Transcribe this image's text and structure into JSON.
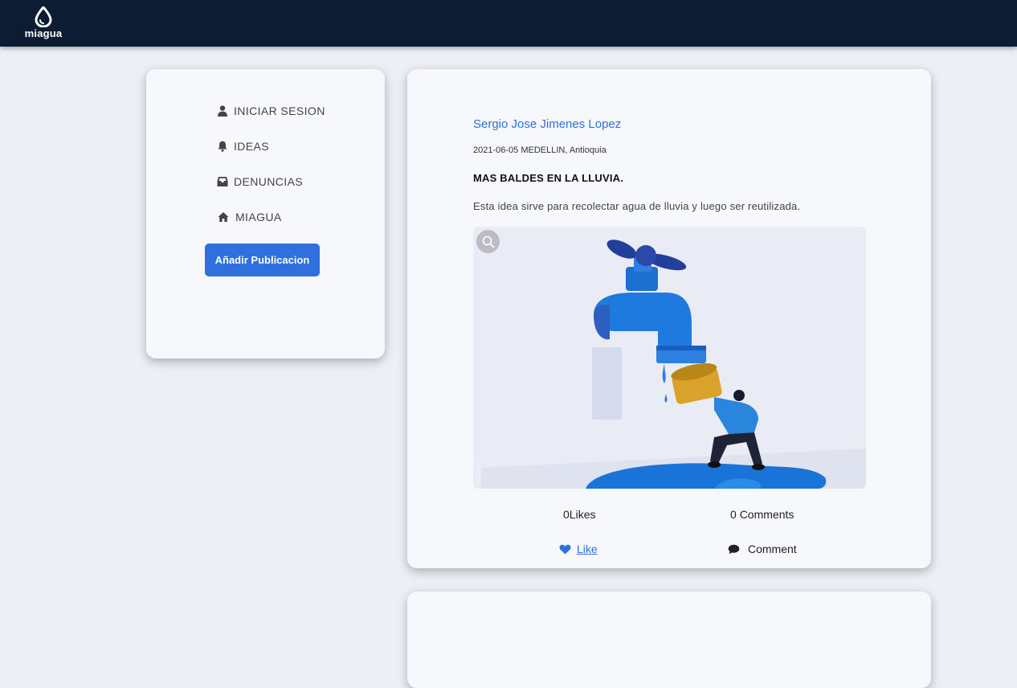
{
  "brand": {
    "name": "miagua"
  },
  "sidebar": {
    "items": [
      {
        "label": "INICIAR SESION",
        "icon": "user-icon"
      },
      {
        "label": "IDEAS",
        "icon": "bell-icon"
      },
      {
        "label": "DENUNCIAS",
        "icon": "inbox-icon"
      },
      {
        "label": "MIAGUA",
        "icon": "home-icon"
      }
    ],
    "add_button": "Añadir Publicacion"
  },
  "post": {
    "author": "Sergio Jose Jimenes Lopez",
    "meta": "2021-06-05 MEDELLIN, Antioquia",
    "title": "MAS BALDES EN LA LLUVIA.",
    "description": "Esta idea sirve para recolectar agua de lluvia y luego ser reutilizada.",
    "image": "faucet-illustration",
    "likes_count": "0",
    "likes_label": "Likes",
    "comments_count": "0",
    "comments_label": "Comments",
    "like_button": "Like",
    "comment_button": "Comment"
  },
  "colors": {
    "header": "#0b1c33",
    "accent": "#2f6fde",
    "background": "#eceff6",
    "card": "#f7f8fc"
  }
}
